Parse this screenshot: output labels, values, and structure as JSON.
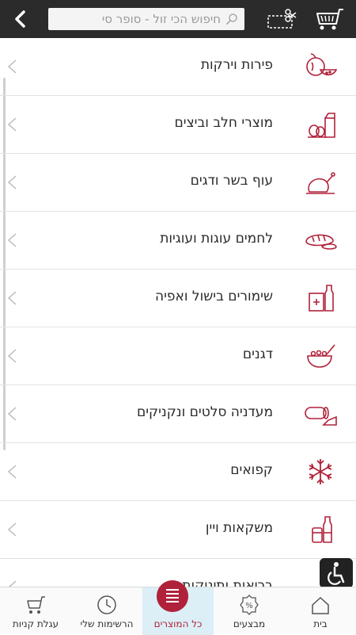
{
  "header": {
    "search_placeholder": "חיפוש הכי זול - סופר סי",
    "icons": [
      "back-icon",
      "search-icon",
      "coupon-scissors-icon",
      "shopping-cart-icon"
    ]
  },
  "categories": [
    {
      "label": "פירות וירקות",
      "icon": "produce-icon"
    },
    {
      "label": "מוצרי חלב וביצים",
      "icon": "dairy-icon"
    },
    {
      "label": "עוף בשר ודגים",
      "icon": "poultry-icon"
    },
    {
      "label": "לחמים עוגות ועוגיות",
      "icon": "bread-icon"
    },
    {
      "label": "שימורים בישול ואפיה",
      "icon": "canned-goods-icon"
    },
    {
      "label": "דגנים",
      "icon": "cereal-bowl-icon"
    },
    {
      "label": "מעדניה סלטים ונקניקים",
      "icon": "deli-icon"
    },
    {
      "label": "קפואים",
      "icon": "snowflake-icon"
    },
    {
      "label": "משקאות ויין",
      "icon": "drinks-icon"
    },
    {
      "label": "בריאות ותינוקות",
      "icon": "health-icon"
    }
  ],
  "bottom_nav": {
    "home": "בית",
    "deals": "מבצעים",
    "all_products": "כל המוצרים",
    "my_lists": "הרשימות שלי",
    "cart": "עגלת קניות"
  },
  "colors": {
    "accent": "#b0223a",
    "header_bg": "#2b2b2b",
    "active_nav_bg": "#dceff7"
  }
}
